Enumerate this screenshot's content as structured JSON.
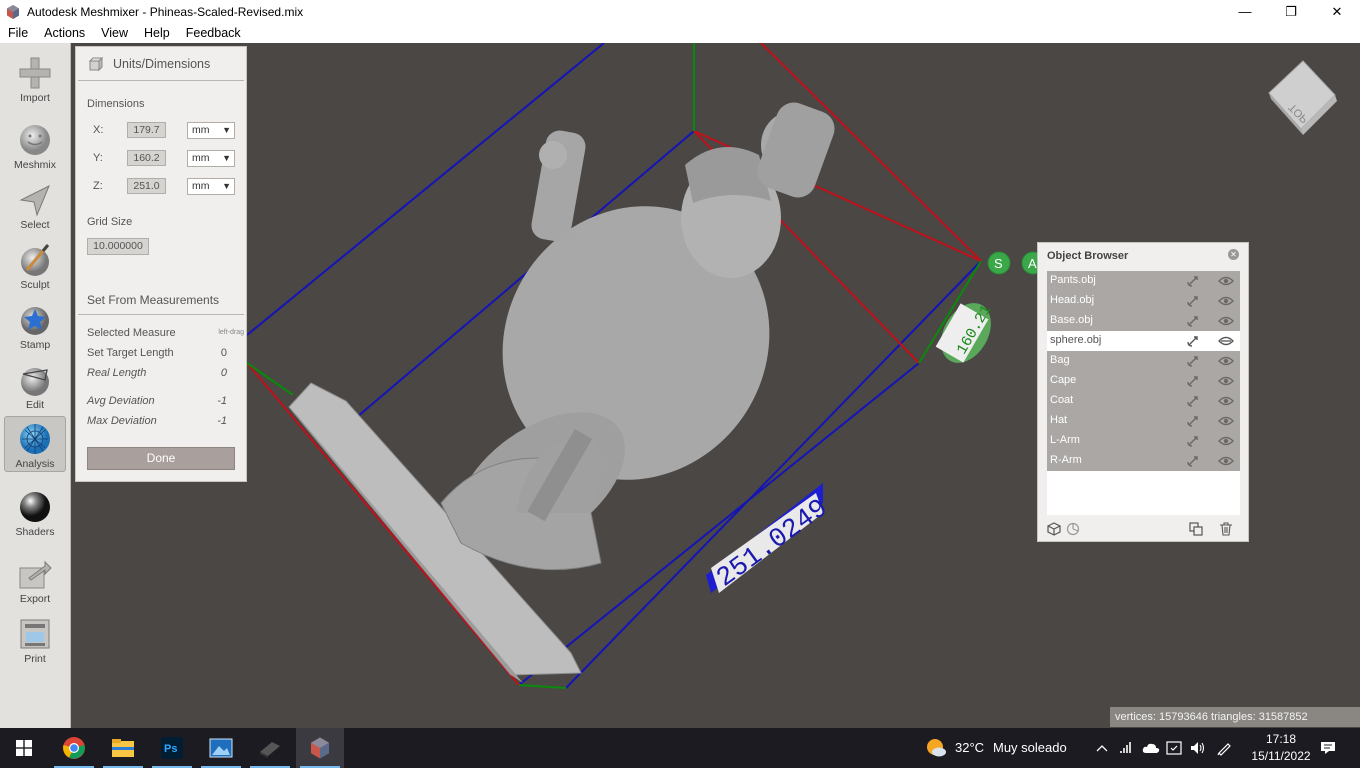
{
  "window": {
    "title": "Autodesk Meshmixer - Phineas-Scaled-Revised.mix",
    "minimize": "—",
    "maximize": "❐",
    "close": "✕"
  },
  "menu": [
    "File",
    "Actions",
    "View",
    "Help",
    "Feedback"
  ],
  "tools": [
    {
      "label": "Import",
      "icon": "import-icon"
    },
    {
      "label": "Meshmix",
      "icon": "meshmix-icon"
    },
    {
      "label": "Select",
      "icon": "select-icon"
    },
    {
      "label": "Sculpt",
      "icon": "sculpt-icon"
    },
    {
      "label": "Stamp",
      "icon": "stamp-icon"
    },
    {
      "label": "Edit",
      "icon": "edit-icon"
    },
    {
      "label": "Analysis",
      "icon": "analysis-icon",
      "active": true
    },
    {
      "label": "Shaders",
      "icon": "shaders-icon"
    },
    {
      "label": "Export",
      "icon": "export-icon"
    },
    {
      "label": "Print",
      "icon": "print-icon"
    }
  ],
  "units_panel": {
    "title": "Units/Dimensions",
    "dimensions_label": "Dimensions",
    "dims": [
      {
        "axis": "X:",
        "value": "179.7",
        "unit": "mm"
      },
      {
        "axis": "Y:",
        "value": "160.2",
        "unit": "mm"
      },
      {
        "axis": "Z:",
        "value": "251.0",
        "unit": "mm"
      }
    ],
    "grid_label": "Grid Size",
    "grid_value": "10.000000",
    "set_from_title": "Set From Measurements",
    "measures": [
      {
        "label": "Selected Measure",
        "value": "left-drag"
      },
      {
        "label": "Set Target Length",
        "value": "0"
      },
      {
        "label": "Real Length",
        "value": "0"
      },
      {
        "label": "Avg Deviation",
        "value": "-1"
      },
      {
        "label": "Max Deviation",
        "value": "-1"
      }
    ],
    "done_label": "Done"
  },
  "viewcube": {
    "face": "TOP"
  },
  "viewport": {
    "measure_z": "251.0249",
    "measure_y": "160.21",
    "pivot_s": "S",
    "pivot_a": "A"
  },
  "object_browser": {
    "title": "Object Browser",
    "objects": [
      {
        "name": "Pants.obj"
      },
      {
        "name": "Head.obj"
      },
      {
        "name": "Base.obj"
      },
      {
        "name": "sphere.obj",
        "selected": true
      },
      {
        "name": "Bag"
      },
      {
        "name": "Cape"
      },
      {
        "name": "Coat"
      },
      {
        "name": "Hat"
      },
      {
        "name": "L-Arm"
      },
      {
        "name": "R-Arm"
      }
    ]
  },
  "status": "vertices: 15793646 triangles: 31587852",
  "taskbar": {
    "weather_temp": "32°C",
    "weather_desc": "Muy soleado",
    "time": "17:18",
    "date": "15/11/2022",
    "apps": [
      "windows-start",
      "chrome",
      "file-explorer",
      "photoshop",
      "photos",
      "app-dark",
      "meshmixer"
    ]
  },
  "colors": {
    "viewport_bg": "#4a4744",
    "bbox_red": "#c0101a",
    "bbox_blue": "#1414b8",
    "bbox_green": "#0a8a0a",
    "selection_row": "#aaa7a4"
  }
}
